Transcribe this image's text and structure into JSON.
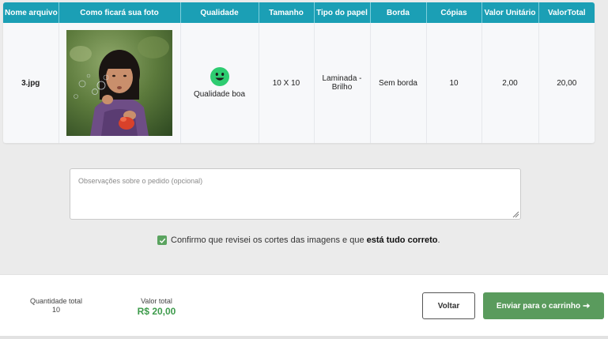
{
  "table": {
    "headers": [
      "Nome arquivo",
      "Como ficará sua foto",
      "Qualidade",
      "Tamanho",
      "Tipo do papel",
      "Borda",
      "Cópias",
      "Valor Unitário",
      "ValorTotal"
    ],
    "rows": [
      {
        "filename": "3.jpg",
        "quality": "Qualidade boa",
        "quality_icon": "smiley-face-icon",
        "size": "10 X 10",
        "paper_type": "Laminada - Brilho",
        "border": "Sem borda",
        "copies": "10",
        "unit_value": "2,00",
        "total_value": "20,00"
      }
    ]
  },
  "notes": {
    "placeholder": "Observações sobre o pedido (opcional)",
    "value": ""
  },
  "confirm": {
    "checked": true,
    "text_before": "Confirmo que revisei os cortes das imagens e que ",
    "text_strong": "está tudo correto",
    "text_after": "."
  },
  "footer": {
    "quantity_label": "Quantidade total",
    "quantity_value": "10",
    "total_label": "Valor total",
    "total_value": "R$ 20,00",
    "back_button": "Voltar",
    "cart_button": "Enviar para o carrinho",
    "cart_icon": "arrow-right-icon"
  },
  "colors": {
    "header_bg": "#1b9fb5",
    "accent_green": "#5a9b5d",
    "total_green": "#3d9b4b",
    "smiley": "#2ecc71"
  }
}
